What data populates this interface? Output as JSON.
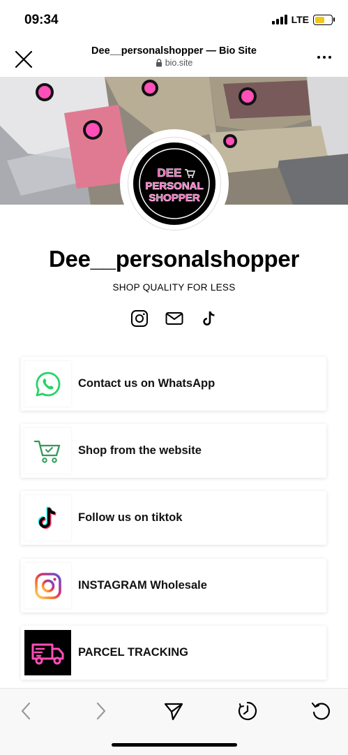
{
  "status_bar": {
    "time": "09:34",
    "network": "LTE",
    "battery_level": 0.6
  },
  "browser": {
    "title": "Dee__personalshopper — Bio Site",
    "url": "bio.site"
  },
  "avatar": {
    "logo_line1": "DEE",
    "logo_line2": "PERSONAL",
    "logo_line3": "SHOPPER"
  },
  "profile": {
    "name": "Dee__personalshopper",
    "tagline": "SHOP QUALITY FOR LESS",
    "social_icons": [
      "instagram-icon",
      "mail-icon",
      "tiktok-icon"
    ]
  },
  "links": [
    {
      "label": "Contact us on WhatsApp",
      "icon": "whatsapp-icon"
    },
    {
      "label": "Shop from the website",
      "icon": "shopping-cart-icon"
    },
    {
      "label": "Follow us on tiktok",
      "icon": "tiktok-icon"
    },
    {
      "label": "INSTAGRAM Wholesale",
      "icon": "instagram-icon"
    },
    {
      "label": "PARCEL TRACKING",
      "icon": "delivery-truck-icon"
    }
  ],
  "toolbar": {
    "icons": [
      "back-icon",
      "forward-icon",
      "share-icon",
      "history-icon",
      "reload-icon"
    ]
  },
  "colors": {
    "brand_pink": "#ff4fb8",
    "whatsapp_green": "#25d366",
    "cart_green": "#2e9a5a"
  }
}
